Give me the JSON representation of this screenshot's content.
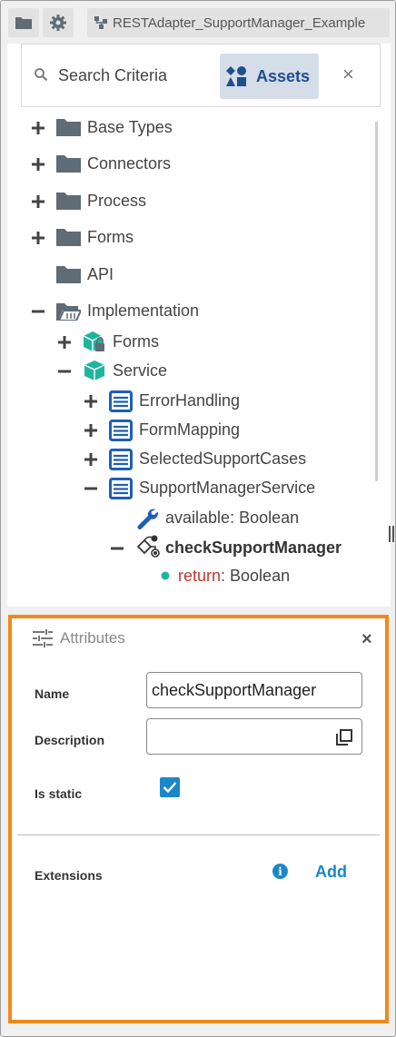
{
  "toolbar": {
    "folder_icon": "folder-icon",
    "settings_icon": "gear-icon",
    "project_icon": "hierarchy-icon",
    "project_name": "RESTAdapter_SupportManager_Example"
  },
  "search": {
    "label": "Search Criteria",
    "assets_label": "Assets",
    "close": "×"
  },
  "tree": {
    "base_types": "Base Types",
    "connectors": "Connectors",
    "process": "Process",
    "forms": "Forms",
    "api": "API",
    "implementation": "Implementation",
    "impl_forms": "Forms",
    "service": "Service",
    "error_handling": "ErrorHandling",
    "form_mapping": "FormMapping",
    "selected_support_cases": "SelectedSupportCases",
    "support_manager_service": "SupportManagerService",
    "available_name": "available",
    "available_type": ": Boolean",
    "check_support_manager": "checkSupportManager",
    "return_name": "return",
    "return_type": ": Boolean"
  },
  "attributes": {
    "title": "Attributes",
    "close": "×",
    "name_label": "Name",
    "name_value": "checkSupportManager",
    "description_label": "Description",
    "description_value": "",
    "is_static_label": "Is static",
    "is_static": true,
    "extensions_label": "Extensions",
    "info": "i",
    "add_label": "Add"
  },
  "colors": {
    "highlight_border": "#ef8a1a",
    "accent": "#1a87c9",
    "folder": "#5f6b75",
    "teal": "#1fb59d",
    "blue_doc": "#1f5fb5",
    "return_red": "#c0392b"
  }
}
